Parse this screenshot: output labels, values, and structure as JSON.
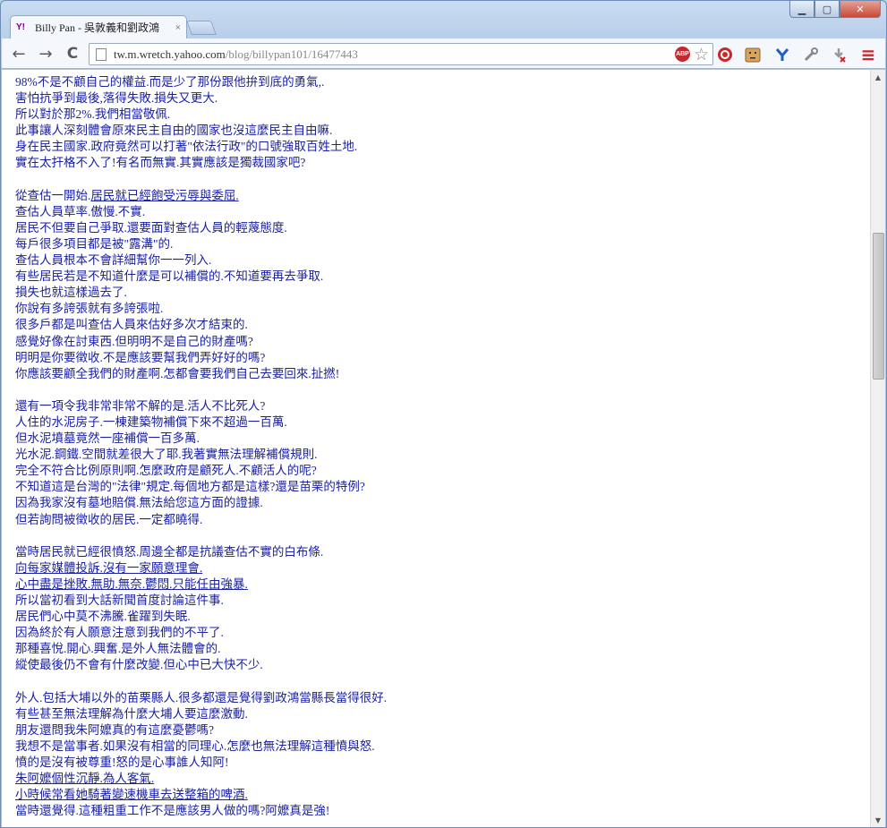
{
  "window": {
    "minimize_icon": "minimize-icon",
    "maximize_icon": "maximize-icon",
    "close_icon": "close-icon"
  },
  "tab": {
    "favicon_text": "Y!",
    "title": "Billy Pan - 吳敦義和劉政鴻",
    "close_glyph": "×"
  },
  "toolbar": {
    "back_glyph": "←",
    "forward_glyph": "→",
    "reload_glyph": "C",
    "url_host": "tw.m.wretch.yahoo.com",
    "url_path": "/blog/billypan101/16477443",
    "abp_label": "ABP",
    "star_glyph": "☆",
    "menu_glyph": "≡"
  },
  "article": {
    "lines": [
      {
        "text": "98%不是不顧自己的權益.而是少了那份跟他拚到底的勇氣,.",
        "u": false
      },
      {
        "text": "害怕抗爭到最後,落得失敗.損失又更大.",
        "u": false
      },
      {
        "text": "所以對於那2%.我們相當敬佩.",
        "u": false
      },
      {
        "text": "此事讓人深刻體會原來民主自由的國家也沒這麼民主自由嘛.",
        "u": false
      },
      {
        "text": "身在民主國家.政府竟然可以打著\"依法行政\"的口號強取百姓土地.",
        "u": false
      },
      {
        "text": "實在太扞格不入了!有名而無實.其實應該是獨裁國家吧?",
        "u": false
      },
      {
        "text": "",
        "u": false
      },
      {
        "text": "從查估一開始.居民就已經飽受污辱與委屈.",
        "u": true,
        "prefix": "從查估一開始."
      },
      {
        "text": "查估人員草率.傲慢.不實.",
        "u": false
      },
      {
        "text": "居民不但要自己爭取.還要面對查估人員的輕蔑態度.",
        "u": false
      },
      {
        "text": "每戶很多項目都是被\"露溝\"的.",
        "u": false
      },
      {
        "text": "查估人員根本不會詳細幫你一一列入.",
        "u": false
      },
      {
        "text": "有些居民若是不知道什麼是可以補償的.不知道要再去爭取.",
        "u": false
      },
      {
        "text": "損失也就這樣過去了.",
        "u": false
      },
      {
        "text": "你說有多誇張就有多誇張啦.",
        "u": false
      },
      {
        "text": "很多戶都是叫查估人員來估好多次才結束的.",
        "u": false
      },
      {
        "text": "感覺好像在討東西.但明明不是自己的財產嗎?",
        "u": false
      },
      {
        "text": "明明是你要徵收.不是應該要幫我們弄好好的嗎?",
        "u": false
      },
      {
        "text": "你應該要顧全我們的財產啊.怎都會要我們自己去要回來.扯撚!",
        "u": false
      },
      {
        "text": "",
        "u": false
      },
      {
        "text": "還有一項令我非常非常不解的是.活人不比死人?",
        "u": false
      },
      {
        "text": "人住的水泥房子.一棟建築物補償下來不超過一百萬.",
        "u": false
      },
      {
        "text": "但水泥墳墓竟然一座補償一百多萬.",
        "u": false
      },
      {
        "text": "光水泥.鋼鐵.空間就差很大了耶.我著實無法理解補償規則.",
        "u": false
      },
      {
        "text": "完全不符合比例原則啊.怎麼政府是顧死人.不顧活人的呢?",
        "u": false
      },
      {
        "text": "不知道這是台灣的\"法律\"規定.每個地方都是這樣?還是苗栗的特例?",
        "u": false
      },
      {
        "text": "因為我家沒有墓地賠償.無法給您這方面的證據.",
        "u": false
      },
      {
        "text": "但若詢問被徵收的居民.一定都曉得.",
        "u": false
      },
      {
        "text": "",
        "u": false
      },
      {
        "text": "當時居民就已經很憤怒.周邊全都是抗議查估不實的白布條.",
        "u": false
      },
      {
        "text": "向每家媒體投訴.沒有一家願意理會.",
        "u": true
      },
      {
        "text": "心中盡是挫敗.無助.無奈.鬱悶.只能任由強暴.",
        "u": true
      },
      {
        "text": "所以當初看到大話新聞首度討論這件事.",
        "u": false
      },
      {
        "text": "居民們心中莫不沸騰.雀躍到失眠.",
        "u": false
      },
      {
        "text": "因為終於有人願意注意到我們的不平了.",
        "u": false
      },
      {
        "text": "那種喜悅.開心.興奮.是外人無法體會的.",
        "u": false
      },
      {
        "text": "縱使最後仍不會有什麼改變.但心中已大快不少.",
        "u": false
      },
      {
        "text": "",
        "u": false
      },
      {
        "text": "外人.包括大埔以外的苗栗縣人.很多都還是覺得劉政鴻當縣長當得很好.",
        "u": false
      },
      {
        "text": "有些甚至無法理解為什麼大埔人要這麼激動.",
        "u": false
      },
      {
        "text": "朋友還問我朱阿嬤真的有這麼憂鬱嗎?",
        "u": false
      },
      {
        "text": "我想不是當事者.如果沒有相當的同理心.怎麼也無法理解這種憤與怒.",
        "u": false
      },
      {
        "text": "憤的是沒有被尊重!怒的是心事誰人知阿!",
        "u": false
      },
      {
        "text": "朱阿嬤個性沉靜.為人客氣.",
        "u": true
      },
      {
        "text": "小時候常看她騎著變速機車去送整箱的啤酒.",
        "u": true
      },
      {
        "text": "當時還覺得.這種粗重工作不是應該男人做的嗎?阿嬤真是強!",
        "u": false
      }
    ]
  },
  "scrollbar": {
    "up_glyph": "▲",
    "down_glyph": "▼"
  }
}
